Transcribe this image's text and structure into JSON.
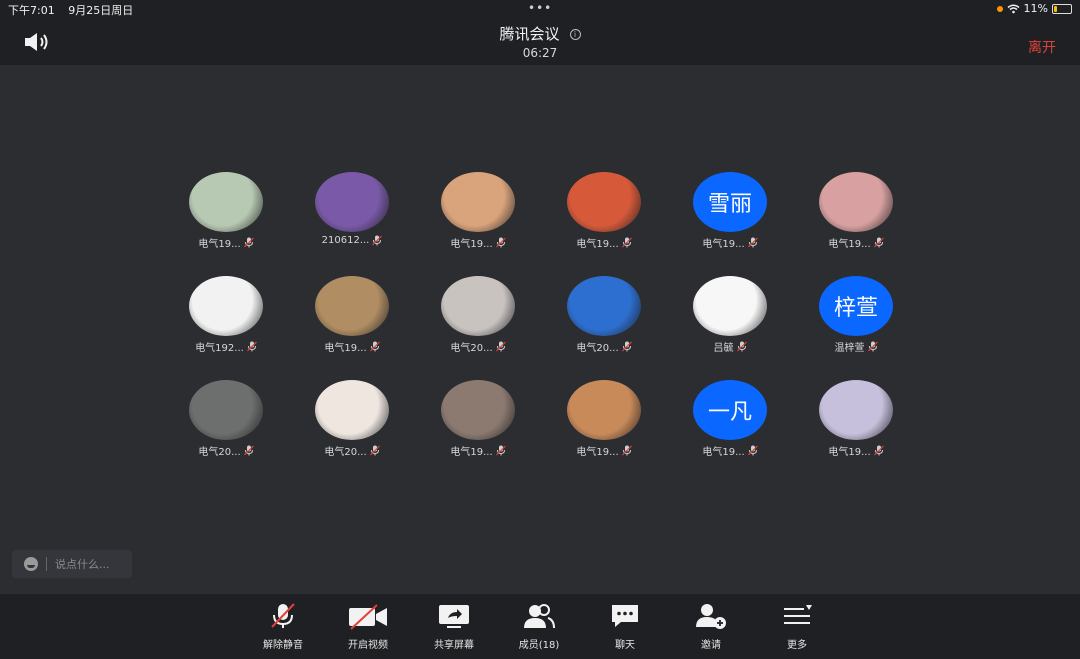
{
  "status_bar": {
    "time": "下午7:01",
    "date": "9月25日周日",
    "dots": "•••",
    "battery": "11%"
  },
  "header": {
    "title": "腾讯会议",
    "timer": "06:27",
    "leave_label": "离开"
  },
  "participants": [
    {
      "name": "电气19...",
      "avatar_text": "",
      "avatar_icon": "anime-character-avatar",
      "color": "#b7c9b2"
    },
    {
      "name": "210612...",
      "avatar_text": "",
      "avatar_icon": "purple-room-avatar",
      "color": "#7a5aa8"
    },
    {
      "name": "电气19...",
      "avatar_text": "",
      "avatar_icon": "shiba-dog-avatar",
      "color": "#d9a37c"
    },
    {
      "name": "电气19...",
      "avatar_text": "",
      "avatar_icon": "cartoon-boy-avatar",
      "color": "#d65a3a"
    },
    {
      "name": "电气19...",
      "avatar_text": "雪丽",
      "avatar_icon": "",
      "color": "#0a67ff"
    },
    {
      "name": "电气19...",
      "avatar_text": "",
      "avatar_icon": "pink-creature-avatar",
      "color": "#d8a0a0"
    },
    {
      "name": "电气192...",
      "avatar_text": "",
      "avatar_icon": "sketch-boy-avatar",
      "color": "#f2f2f2"
    },
    {
      "name": "电气19...",
      "avatar_text": "",
      "avatar_icon": "puppy-box-avatar",
      "color": "#b08d62"
    },
    {
      "name": "电气20...",
      "avatar_text": "",
      "avatar_icon": "girl-cap-avatar",
      "color": "#c9c3c0"
    },
    {
      "name": "电气20...",
      "avatar_text": "",
      "avatar_icon": "blue-sky-avatar",
      "color": "#2d6fd0"
    },
    {
      "name": "吕毓",
      "avatar_text": "",
      "avatar_icon": "mushroom-doodle-avatar",
      "color": "#f7f7f7"
    },
    {
      "name": "温梓萱",
      "avatar_text": "梓萱",
      "avatar_icon": "",
      "color": "#0a67ff"
    },
    {
      "name": "电气20...",
      "avatar_text": "",
      "avatar_icon": "grey-portrait-avatar",
      "color": "#6d6f6e"
    },
    {
      "name": "电气20...",
      "avatar_text": "",
      "avatar_icon": "white-puppy-avatar",
      "color": "#efe6e0"
    },
    {
      "name": "电气19...",
      "avatar_text": "",
      "avatar_icon": "couple-cat-avatar",
      "color": "#8c7a70"
    },
    {
      "name": "电气19...",
      "avatar_text": "",
      "avatar_icon": "kitten-headphones-avatar",
      "color": "#c98a5a"
    },
    {
      "name": "电气19...",
      "avatar_text": "一凡",
      "avatar_icon": "",
      "color": "#0a67ff"
    },
    {
      "name": "电气19...",
      "avatar_text": "",
      "avatar_icon": "anime-sky-avatar",
      "color": "#c7c0dc"
    }
  ],
  "chat": {
    "placeholder": "说点什么..."
  },
  "toolbar": {
    "unmute_label": "解除静音",
    "video_label": "开启视频",
    "share_label": "共享屏幕",
    "members_label": "成员(18)",
    "chat_label": "聊天",
    "invite_label": "邀请",
    "more_label": "更多"
  }
}
